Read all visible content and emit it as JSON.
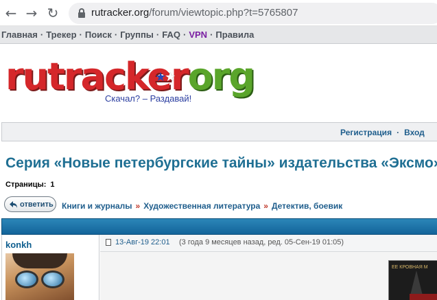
{
  "browser": {
    "url_host": "rutracker.org",
    "url_path": "/forum/viewtopic.php?t=5765807"
  },
  "topnav": {
    "items": [
      "Главная",
      "Трекер",
      "Поиск",
      "Группы",
      "FAQ",
      "VPN",
      "Правила"
    ]
  },
  "logo": {
    "text_ru": "rutracker",
    "text_org": "org",
    "slogan": "Скачал? – Раздавай!"
  },
  "login": {
    "register": "Регистрация",
    "login": "Вход"
  },
  "topic": {
    "title": "Серия «Новые петербургские тайны» издательства «Эксмо»",
    "pages_label": "Страницы:",
    "pages_value": "1"
  },
  "reply_button": {
    "label": "ответить"
  },
  "breadcrumbs": [
    "Книги и журналы",
    "Художественная литература",
    "Детектив, боевик"
  ],
  "post": {
    "author": "konkh",
    "date": "13-Авг-19 22:01",
    "ago": "(3 года 9 месяцев назад, ред. 05-Сен-19 01:05)",
    "cover_text": "ЕЕ КРОВНАЯ М"
  },
  "colors": {
    "link": "#1e5d8c",
    "title": "#1f6f93",
    "header_bar": "#1d72a6",
    "vpn": "#7a1fa2"
  }
}
